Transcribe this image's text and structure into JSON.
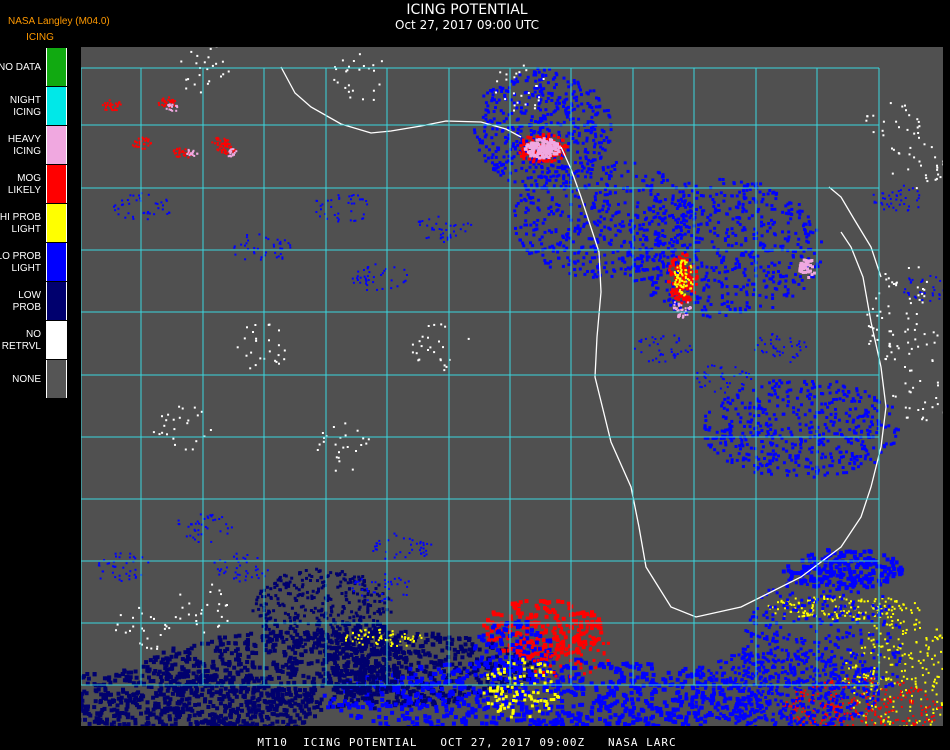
{
  "header": {
    "credit": "NASA Langley (M04.0)",
    "product": "ICING",
    "title": "ICING POTENTIAL",
    "subtitle": "Oct 27, 2017 09:00 UTC"
  },
  "legend": [
    {
      "label": "NO DATA",
      "color": "#11aa11"
    },
    {
      "label": "NIGHT\nICING",
      "color": "#00e8e8"
    },
    {
      "label": "HEAVY\nICING",
      "color": "#f0a8e0"
    },
    {
      "label": "MOG\nLIKELY",
      "color": "#ff0000"
    },
    {
      "label": "HI PROB\nLIGHT",
      "color": "#ffff00"
    },
    {
      "label": "LO PROB\nLIGHT",
      "color": "#0000ff"
    },
    {
      "label": "LOW\nPROB",
      "color": "#00006e"
    },
    {
      "label": "NO\nRETRVL",
      "color": "#ffffff"
    },
    {
      "label": "NONE",
      "color": "#555555"
    }
  ],
  "map": {
    "background_color": "#505050",
    "grid_color": "#3ad6de",
    "grid_label_color": "#e0202a",
    "coastline_color": "#ffffff"
  },
  "footer": "MT10  ICING POTENTIAL   OCT 27, 2017 09:00Z   NASA LARC"
}
